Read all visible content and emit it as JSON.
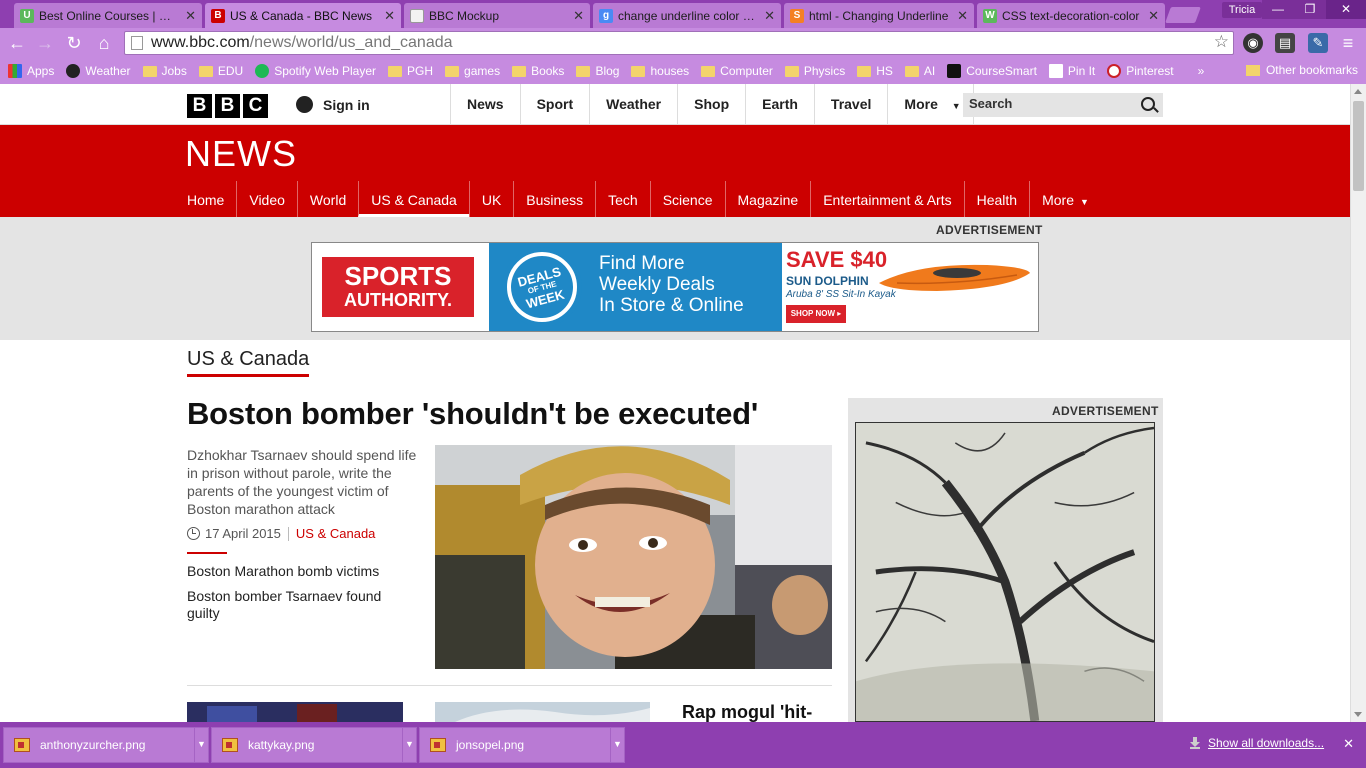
{
  "browser": {
    "tabs": [
      {
        "label": "Best Online Courses | Ude",
        "favicon": "udemy-icon",
        "color": "#5cb85c",
        "glyph": "U"
      },
      {
        "label": "US & Canada - BBC News",
        "favicon": "bbc-icon",
        "color": "#c00",
        "glyph": "B",
        "active": true
      },
      {
        "label": "BBC Mockup",
        "favicon": "page-icon",
        "color": "#eee",
        "glyph": ""
      },
      {
        "label": "change underline color - G",
        "favicon": "google-icon",
        "color": "#4a8af4",
        "glyph": "g"
      },
      {
        "label": "html - Changing Underline",
        "favicon": "stackoverflow-icon",
        "color": "#f48024",
        "glyph": "S"
      },
      {
        "label": "CSS text-decoration-color",
        "favicon": "w3schools-icon",
        "color": "#5cb85c",
        "glyph": "W"
      }
    ],
    "profile": "Tricia",
    "url_host": "www.bbc.com",
    "url_path": "/news/world/us_and_canada",
    "bookmarks": [
      {
        "label": "Apps",
        "icon": "apps-grid-icon"
      },
      {
        "label": "Weather",
        "icon": "weather-icon"
      },
      {
        "label": "Jobs",
        "icon": "folder-icon"
      },
      {
        "label": "EDU",
        "icon": "folder-icon"
      },
      {
        "label": "Spotify Web Player",
        "icon": "spotify-icon"
      },
      {
        "label": "PGH",
        "icon": "folder-icon"
      },
      {
        "label": "games",
        "icon": "folder-icon"
      },
      {
        "label": "Books",
        "icon": "folder-icon"
      },
      {
        "label": "Blog",
        "icon": "folder-icon"
      },
      {
        "label": "houses",
        "icon": "folder-icon"
      },
      {
        "label": "Computer",
        "icon": "folder-icon"
      },
      {
        "label": "Physics",
        "icon": "folder-icon"
      },
      {
        "label": "HS",
        "icon": "folder-icon"
      },
      {
        "label": "AI",
        "icon": "folder-icon"
      },
      {
        "label": "CourseSmart",
        "icon": "coursesmart-icon"
      },
      {
        "label": "Pin It",
        "icon": "pin-icon"
      },
      {
        "label": "Pinterest",
        "icon": "pinterest-icon"
      }
    ],
    "bookmarks_overflow": "»",
    "other_bookmarks": "Other bookmarks"
  },
  "bbc": {
    "logo_letters": [
      "B",
      "B",
      "C"
    ],
    "sign_in": "Sign in",
    "top_nav": [
      "News",
      "Sport",
      "Weather",
      "Shop",
      "Earth",
      "Travel",
      "More"
    ],
    "search_placeholder": "Search",
    "news_logo": "NEWS",
    "sub_nav": [
      "Home",
      "Video",
      "World",
      "US & Canada",
      "UK",
      "Business",
      "Tech",
      "Science",
      "Magazine",
      "Entertainment & Arts",
      "Health",
      "More"
    ],
    "active_sub_nav": "US & Canada",
    "advertisement_label": "ADVERTISEMENT"
  },
  "banner_ad": {
    "brand_line1": "SPORTS",
    "brand_line2": "AUTHORITY.",
    "deals_line1": "DEALS",
    "deals_line2": "OF THE",
    "deals_line3": "WEEK",
    "headline_line1": "Find More",
    "headline_line2": "Weekly Deals",
    "headline_line3": "In Store & Online",
    "save": "SAVE $40",
    "product_line1": "SUN DOLPHIN",
    "product_line2": "Aruba 8' SS Sit-In Kayak",
    "cta": "SHOP NOW ▸"
  },
  "main": {
    "section_title": "US & Canada",
    "headline": "Boston bomber 'shouldn't be executed'",
    "summary": "Dzhokhar Tsarnaev should spend life in prison without parole, write the parents of the youngest victim of Boston marathon attack",
    "date": "17 April 2015",
    "tag": "US & Canada",
    "related": [
      "Boston Marathon bomb victims",
      "Boston bomber Tsarnaev found guilty"
    ],
    "next_story": "Rap mogul 'hit-"
  },
  "downloads": {
    "files": [
      "anthonyzurcher.png",
      "kattykay.png",
      "jonsopel.png"
    ],
    "show_all": "Show all downloads...",
    "close": "✕"
  },
  "colors": {
    "chrome_purple": "#8e3fb0",
    "toolbar_purple": "#c68be0",
    "bbc_red": "#cc0000"
  }
}
